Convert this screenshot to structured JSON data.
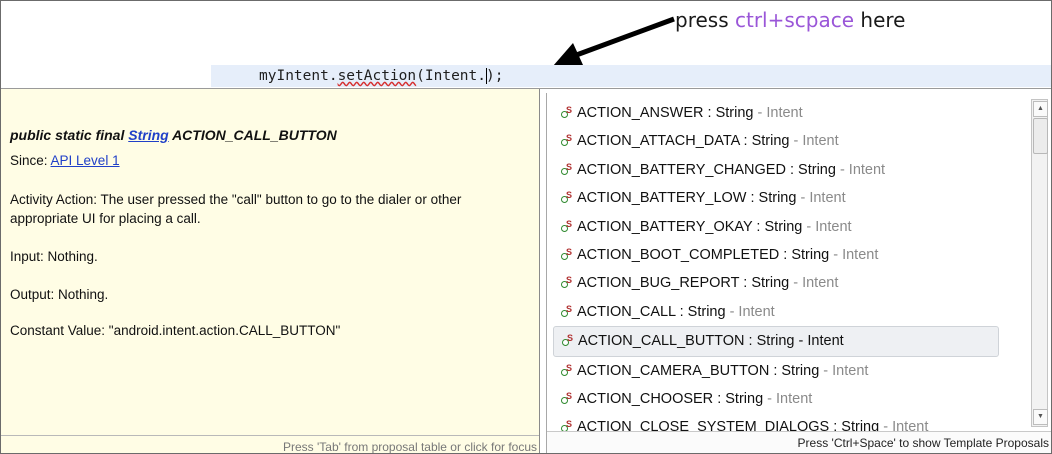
{
  "annotation": {
    "prefix": "press ",
    "keys": "ctrl+scpace",
    "suffix": " here"
  },
  "editor": {
    "code_before": "myIntent.",
    "code_method": "setAction",
    "code_after": "(Intent.",
    "code_end": ");"
  },
  "doc": {
    "modifiers": "public static final ",
    "type_link": "String",
    "name": " ACTION_CALL_BUTTON",
    "since_label": "Since: ",
    "since_link": "API Level 1",
    "description": "Activity Action: The user pressed the \"call\" button to go to the dialer or other appropriate UI for placing a call.",
    "input": "Input: Nothing.",
    "output": "Output: Nothing.",
    "constant": "Constant Value: \"android.intent.action.CALL_BUTTON\"",
    "status": "Press 'Tab' from proposal table or click for focus"
  },
  "proposals": {
    "items": [
      {
        "name": "ACTION_ANSWER",
        "type": " : String",
        "cls": " - Intent"
      },
      {
        "name": "ACTION_ATTACH_DATA",
        "type": " : String",
        "cls": " - Intent"
      },
      {
        "name": "ACTION_BATTERY_CHANGED",
        "type": " : String",
        "cls": " - Intent"
      },
      {
        "name": "ACTION_BATTERY_LOW",
        "type": " : String",
        "cls": " - Intent"
      },
      {
        "name": "ACTION_BATTERY_OKAY",
        "type": " : String",
        "cls": " - Intent"
      },
      {
        "name": "ACTION_BOOT_COMPLETED",
        "type": " : String",
        "cls": " - Intent"
      },
      {
        "name": "ACTION_BUG_REPORT",
        "type": " : String",
        "cls": " - Intent"
      },
      {
        "name": "ACTION_CALL",
        "type": " : String",
        "cls": " - Intent"
      },
      {
        "name": "ACTION_CALL_BUTTON",
        "type": " : String",
        "cls": " - Intent"
      },
      {
        "name": "ACTION_CAMERA_BUTTON",
        "type": " : String",
        "cls": " - Intent"
      },
      {
        "name": "ACTION_CHOOSER",
        "type": " : String",
        "cls": " - Intent"
      },
      {
        "name": "ACTION_CLOSE_SYSTEM_DIALOGS",
        "type": " : String",
        "cls": " - Intent"
      }
    ],
    "selected_index": 8,
    "icon": "static-field-icon",
    "icon_mark": "S",
    "status": "Press 'Ctrl+Space' to show Template Proposals"
  },
  "colors": {
    "accent_keys": "#9a56d8",
    "link": "#2040c8",
    "doc_bg": "#fffde5",
    "error_underline": "#d63030"
  }
}
